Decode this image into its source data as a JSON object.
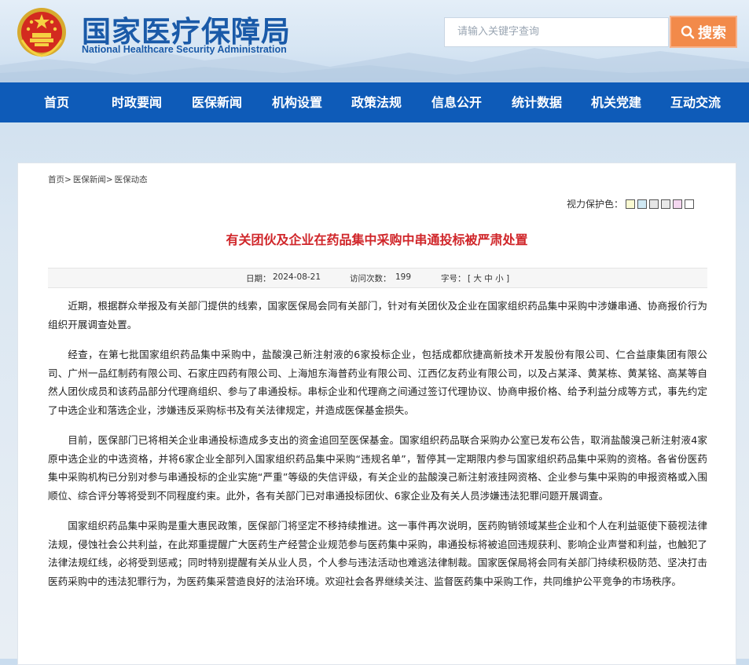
{
  "header": {
    "title_cn": "国家医疗保障局",
    "title_en": "National Healthcare Security Administration",
    "search": {
      "placeholder": "请输入关键字查询",
      "button_label": "搜索"
    }
  },
  "nav": {
    "items": [
      {
        "label": "首页"
      },
      {
        "label": "时政要闻"
      },
      {
        "label": "医保新闻"
      },
      {
        "label": "机构设置"
      },
      {
        "label": "政策法规"
      },
      {
        "label": "信息公开"
      },
      {
        "label": "统计数据"
      },
      {
        "label": "机关党建"
      },
      {
        "label": "互动交流"
      }
    ]
  },
  "breadcrumb": {
    "items": [
      "首页>",
      "医保新闻>",
      "医保动态"
    ]
  },
  "vision": {
    "label": "视力保护色：",
    "colors": [
      "#fafad2",
      "#cfe8f3",
      "#e6e6e6",
      "#e8e8e8",
      "#f5d7f0",
      "#ffffff"
    ]
  },
  "article": {
    "title": "有关团伙及企业在药品集中采购中串通投标被严肃处置",
    "date_label": "日期：",
    "date": "2024-08-21",
    "visits_label": "访问次数：",
    "visits": "199",
    "size_label": "字号：",
    "size_options": "[ 大 中 小 ]",
    "paragraphs": [
      "近期，根据群众举报及有关部门提供的线索，国家医保局会同有关部门，针对有关团伙及企业在国家组织药品集中采购中涉嫌串通、协商报价行为组织开展调查处置。",
      "经查，在第七批国家组织药品集中采购中，盐酸溴己新注射液的6家投标企业，包括成都欣捷高新技术开发股份有限公司、仁合益康集团有限公司、广州一品红制药有限公司、石家庄四药有限公司、上海旭东海普药业有限公司、江西亿友药业有限公司，以及占某泽、黄某栋、黄某铭、高某等自然人团伙成员和该药品部分代理商组织、参与了串通投标。串标企业和代理商之间通过签订代理协议、协商申报价格、给予利益分成等方式，事先约定了中选企业和落选企业，涉嫌违反采购标书及有关法律规定，并造成医保基金损失。",
      "目前，医保部门已将相关企业串通投标造成多支出的资金追回至医保基金。国家组织药品联合采购办公室已发布公告，取消盐酸溴己新注射液4家原中选企业的中选资格，并将6家企业全部列入国家组织药品集中采购“违规名单”，暂停其一定期限内参与国家组织药品集中采购的资格。各省份医药集中采购机构已分别对参与串通投标的企业实施“严重”等级的失信评级，有关企业的盐酸溴己新注射液挂网资格、企业参与集中采购的申报资格或入围顺位、综合评分等将受到不同程度约束。此外，各有关部门已对串通投标团伙、6家企业及有关人员涉嫌违法犯罪问题开展调查。",
      "国家组织药品集中采购是重大惠民政策，医保部门将坚定不移持续推进。这一事件再次说明，医药购销领域某些企业和个人在利益驱使下藐视法律法规，侵蚀社会公共利益，在此郑重提醒广大医药生产经营企业规范参与医药集中采购，串通投标将被追回违规获利、影响企业声誉和利益，也触犯了法律法规红线，必将受到惩戒；同时特别提醒有关从业人员，个人参与违法活动也难逃法律制裁。国家医保局将会同有关部门持续积极防范、坚决打击医药采购中的违法犯罪行为，为医药集采营造良好的法治环境。欢迎社会各界继续关注、监督医药集中采购工作，共同维护公平竞争的市场秩序。"
    ]
  },
  "colors": {
    "nav_bg": "#0e5bb8",
    "title_red": "#d0262a",
    "search_orange": "#f28a4a",
    "brand_blue": "#1a5aa8"
  }
}
